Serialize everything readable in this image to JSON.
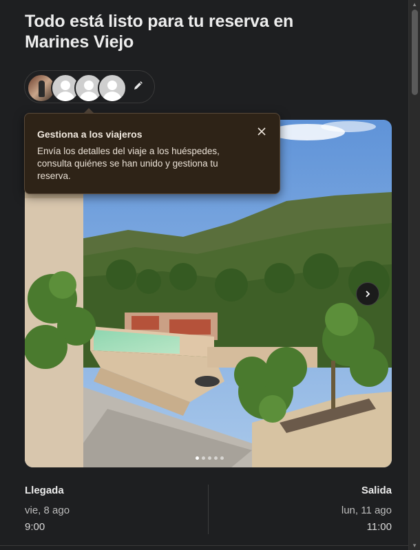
{
  "page": {
    "title": "Todo está listo para tu reserva en Marines Viejo"
  },
  "travelers": {
    "avatars": [
      {
        "type": "photo"
      },
      {
        "type": "placeholder"
      },
      {
        "type": "placeholder"
      },
      {
        "type": "placeholder"
      }
    ],
    "edit_icon": "pencil-icon"
  },
  "tooltip": {
    "title": "Gestiona a los viajeros",
    "body": "Envía los detalles del viaje a los huéspedes, consulta quiénes se han unido y gestiona tu reserva.",
    "close_icon": "close-icon"
  },
  "gallery": {
    "image_description_icon": "villa-pool-mountain-photo",
    "next_icon": "chevron-right-icon",
    "dot_count": 5,
    "active_dot": 0
  },
  "checkin": {
    "label": "Llegada",
    "date": "vie, 8 ago",
    "time": "9:00"
  },
  "checkout": {
    "label": "Salida",
    "date": "lun, 11 ago",
    "time": "11:00"
  },
  "colors": {
    "background": "#1e1f21",
    "tooltip_bg": "#2e2317",
    "text_primary": "#ececec",
    "text_secondary": "#bdbdbd"
  }
}
